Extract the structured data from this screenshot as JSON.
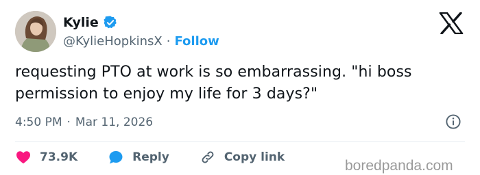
{
  "author": {
    "name": "Kylie",
    "handle": "@KylieHopkinsX",
    "separator": "·",
    "follow_label": "Follow",
    "verified_icon": "verified-badge-icon"
  },
  "platform_logo": "x-logo-icon",
  "tweet": {
    "text": "requesting PTO at work is so embarrassing. \"hi boss permission to enjoy my life for 3 days?\"",
    "time": "4:50 PM",
    "separator": "·",
    "date": "Mar 11, 2026"
  },
  "actions": {
    "like_count": "73.9K",
    "reply_label": "Reply",
    "copy_link_label": "Copy link"
  },
  "watermark": "boredpanda.com",
  "colors": {
    "accent": "#1d9bf0",
    "like": "#f91880",
    "text": "#0f1419",
    "muted": "#536471"
  }
}
